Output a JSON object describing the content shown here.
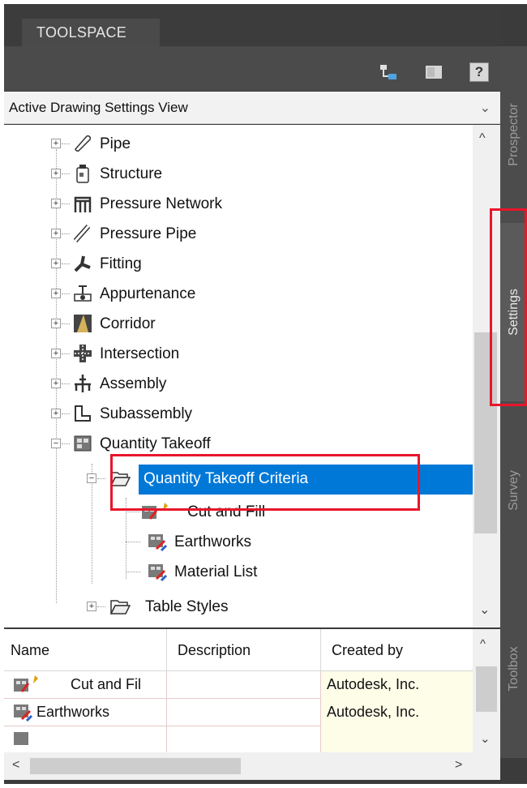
{
  "window": {
    "title": "TOOLSPACE",
    "help_label": "?"
  },
  "view_select": {
    "value": "Active Drawing Settings View",
    "chevron": "⌄"
  },
  "side_tabs": [
    {
      "label": "Prospector"
    },
    {
      "label": "Settings"
    },
    {
      "label": "Survey"
    },
    {
      "label": "Toolbox"
    }
  ],
  "tree": {
    "items": [
      {
        "label": "Pipe",
        "icon": "pipe-icon",
        "expander": "+"
      },
      {
        "label": "Structure",
        "icon": "structure-icon",
        "expander": "+"
      },
      {
        "label": "Pressure Network",
        "icon": "pressure-network-icon",
        "expander": "+"
      },
      {
        "label": "Pressure Pipe",
        "icon": "pressure-pipe-icon",
        "expander": "+"
      },
      {
        "label": "Fitting",
        "icon": "fitting-icon",
        "expander": "+"
      },
      {
        "label": "Appurtenance",
        "icon": "appurtenance-icon",
        "expander": "+"
      },
      {
        "label": "Corridor",
        "icon": "corridor-icon",
        "expander": "+"
      },
      {
        "label": "Intersection",
        "icon": "intersection-icon",
        "expander": "+"
      },
      {
        "label": "Assembly",
        "icon": "assembly-icon",
        "expander": "+"
      },
      {
        "label": "Subassembly",
        "icon": "subassembly-icon",
        "expander": "+"
      },
      {
        "label": "Quantity Takeoff",
        "icon": "quantity-takeoff-icon",
        "expander": "−"
      },
      {
        "label": "Quantity Takeoff Criteria",
        "icon": "folder-open-icon",
        "expander": "−"
      },
      {
        "label": "Cut and Fill",
        "icon": "criteria-icon"
      },
      {
        "label": "Earthworks",
        "icon": "criteria-icon"
      },
      {
        "label": "Material List",
        "icon": "criteria-icon"
      },
      {
        "label": "Table Styles",
        "icon": "folder-icon",
        "expander": "+"
      }
    ]
  },
  "scroll": {
    "up": "^",
    "down": "⌄",
    "left": "<",
    "right": ">"
  },
  "list": {
    "columns": [
      "Name",
      "Description",
      "Created by"
    ],
    "rows": [
      {
        "name": "Cut and Fil",
        "description": "",
        "created_by": "Autodesk, Inc."
      },
      {
        "name": "Earthworks",
        "description": "",
        "created_by": "Autodesk, Inc."
      }
    ]
  },
  "colors": {
    "selection": "#0078d7",
    "annotation": "#e8162b",
    "panel_dark": "#3c3c3c"
  }
}
